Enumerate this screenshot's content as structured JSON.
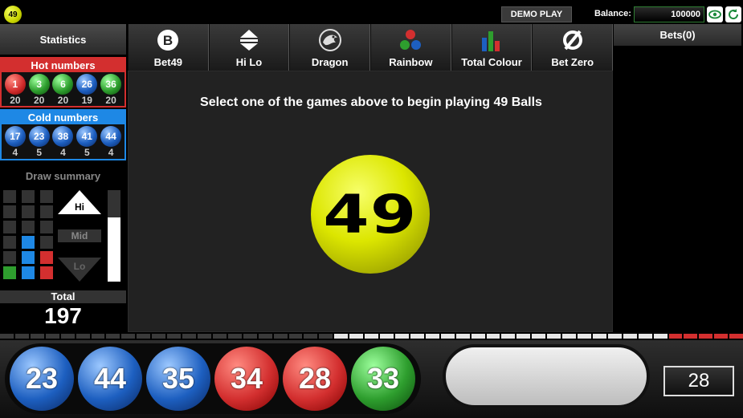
{
  "header": {
    "logo_text": "49",
    "demo_label": "DEMO PLAY",
    "balance_label": "Balance:",
    "balance_value": "100000"
  },
  "statistics": {
    "title": "Statistics",
    "hot": {
      "title": "Hot numbers",
      "balls": [
        {
          "number": "1",
          "count": "20",
          "color": "red"
        },
        {
          "number": "3",
          "count": "20",
          "color": "green"
        },
        {
          "number": "6",
          "count": "20",
          "color": "green"
        },
        {
          "number": "26",
          "count": "19",
          "color": "blue"
        },
        {
          "number": "36",
          "count": "20",
          "color": "green"
        }
      ]
    },
    "cold": {
      "title": "Cold numbers",
      "balls": [
        {
          "number": "17",
          "count": "4",
          "color": "blue"
        },
        {
          "number": "23",
          "count": "5",
          "color": "blue"
        },
        {
          "number": "38",
          "count": "4",
          "color": "blue"
        },
        {
          "number": "41",
          "count": "5",
          "color": "blue"
        },
        {
          "number": "44",
          "count": "4",
          "color": "blue"
        }
      ]
    },
    "draw_summary": {
      "title": "Draw summary",
      "grid": [
        [
          "",
          "",
          ""
        ],
        [
          "",
          "",
          ""
        ],
        [
          "",
          "",
          ""
        ],
        [
          "",
          "b",
          ""
        ],
        [
          "",
          "b",
          "r"
        ],
        [
          "g",
          "b",
          "r"
        ]
      ],
      "hi_label": "Hi",
      "mid_label": "Mid",
      "lo_label": "Lo",
      "bar_fraction": 0.7
    },
    "total_label": "Total",
    "total_value": "197"
  },
  "tabs": [
    {
      "label": "Bet49",
      "icon": "b-circle-icon"
    },
    {
      "label": "Hi Lo",
      "icon": "up-down-arrows-icon"
    },
    {
      "label": "Dragon",
      "icon": "dragon-icon"
    },
    {
      "label": "Rainbow",
      "icon": "three-dots-icon"
    },
    {
      "label": "Total Colour",
      "icon": "bar-chart-icon"
    },
    {
      "label": "Bet Zero",
      "icon": "empty-set-icon"
    }
  ],
  "main": {
    "prompt": "Select one of the games above to begin playing 49 Balls",
    "ball_number": "49"
  },
  "bets": {
    "title": "Bets(0)"
  },
  "results": {
    "balls": [
      {
        "number": "23",
        "color": "blue"
      },
      {
        "number": "44",
        "color": "blue"
      },
      {
        "number": "35",
        "color": "blue"
      },
      {
        "number": "34",
        "color": "red"
      },
      {
        "number": "28",
        "color": "red"
      },
      {
        "number": "33",
        "color": "green"
      }
    ],
    "counter": "28",
    "strip": [
      "d",
      "d",
      "d",
      "d",
      "d",
      "d",
      "d",
      "d",
      "d",
      "d",
      "d",
      "d",
      "d",
      "d",
      "d",
      "d",
      "d",
      "d",
      "d",
      "d",
      "d",
      "d",
      "w",
      "w",
      "w",
      "w",
      "w",
      "w",
      "w",
      "w",
      "w",
      "w",
      "w",
      "w",
      "w",
      "w",
      "w",
      "w",
      "w",
      "w",
      "w",
      "w",
      "w",
      "w",
      "r",
      "r",
      "r",
      "r",
      "r"
    ]
  },
  "colors": {
    "red": "#d32f2f",
    "green": "#2e9e2e",
    "blue": "#1d5fc0",
    "ball_yellow": "#dce600"
  }
}
